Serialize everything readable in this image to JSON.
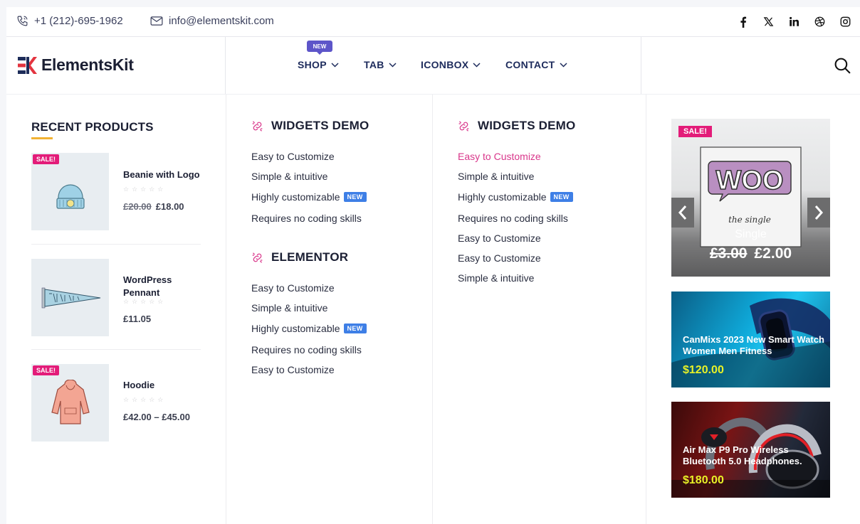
{
  "topbar": {
    "phone": "+1 (212)-695-1962",
    "email": "info@elementskit.com",
    "social": [
      "facebook-icon",
      "x-icon",
      "linkedin-icon",
      "dribbble-icon",
      "instagram-icon"
    ]
  },
  "header": {
    "logo_text": "ElementsKit",
    "nav": [
      {
        "label": "SHOP",
        "badge": "NEW"
      },
      {
        "label": "TAB"
      },
      {
        "label": "ICONBOX"
      },
      {
        "label": "CONTACT"
      }
    ]
  },
  "recent": {
    "title": "RECENT PRODUCTS",
    "products": [
      {
        "name": "Beanie with Logo",
        "sale": "SALE!",
        "old_price": "£20.00",
        "price": "£18.00",
        "stars": "☆☆☆☆☆"
      },
      {
        "name": "WordPress Pennant",
        "price": "£11.05",
        "stars": "☆☆☆☆☆"
      },
      {
        "name": "Hoodie",
        "sale": "SALE!",
        "price": "£42.00 – £45.00",
        "stars": "☆☆☆☆☆"
      }
    ]
  },
  "col2": {
    "sec1_title": "WIDGETS DEMO",
    "sec1_links": [
      "Easy to Customize",
      "Simple & intuitive",
      "Highly customizable",
      "Requires no coding skills"
    ],
    "sec2_title": "ELEMENTOR",
    "sec2_links": [
      "Easy to Customize",
      "Simple & intuitive",
      "Highly customizable",
      "Requires no coding skills",
      "Easy to Customize"
    ],
    "new_tag": "NEW"
  },
  "col3": {
    "title": "WIDGETS DEMO",
    "links": [
      "Easy to Customize",
      "Simple & intuitive",
      "Highly customizable",
      "Requires no coding skills",
      "Easy to Customize",
      "Easy to Customize",
      "Simple & intuitive"
    ],
    "new_tag": "NEW"
  },
  "col4": {
    "slide": {
      "sale": "SALE!",
      "logo_text": "WOO",
      "script_text": "the single",
      "name": "Single",
      "old_price": "£3.00",
      "price": "£2.00"
    },
    "cards": [
      {
        "title": "CanMixs 2023 New Smart Watch Women Men Fitness",
        "price": "$120.00"
      },
      {
        "title": "Air Max P9 Pro Wireless Bluetooth 5.0 Headphones.",
        "price": "$180.00"
      }
    ]
  },
  "colors": {
    "accent_pink": "#e31c79",
    "nav_navy": "#1d2b5c",
    "new_blue": "#3e7fe6",
    "badge_purple": "#5d55c9",
    "price_yellow": "#e8f127"
  }
}
